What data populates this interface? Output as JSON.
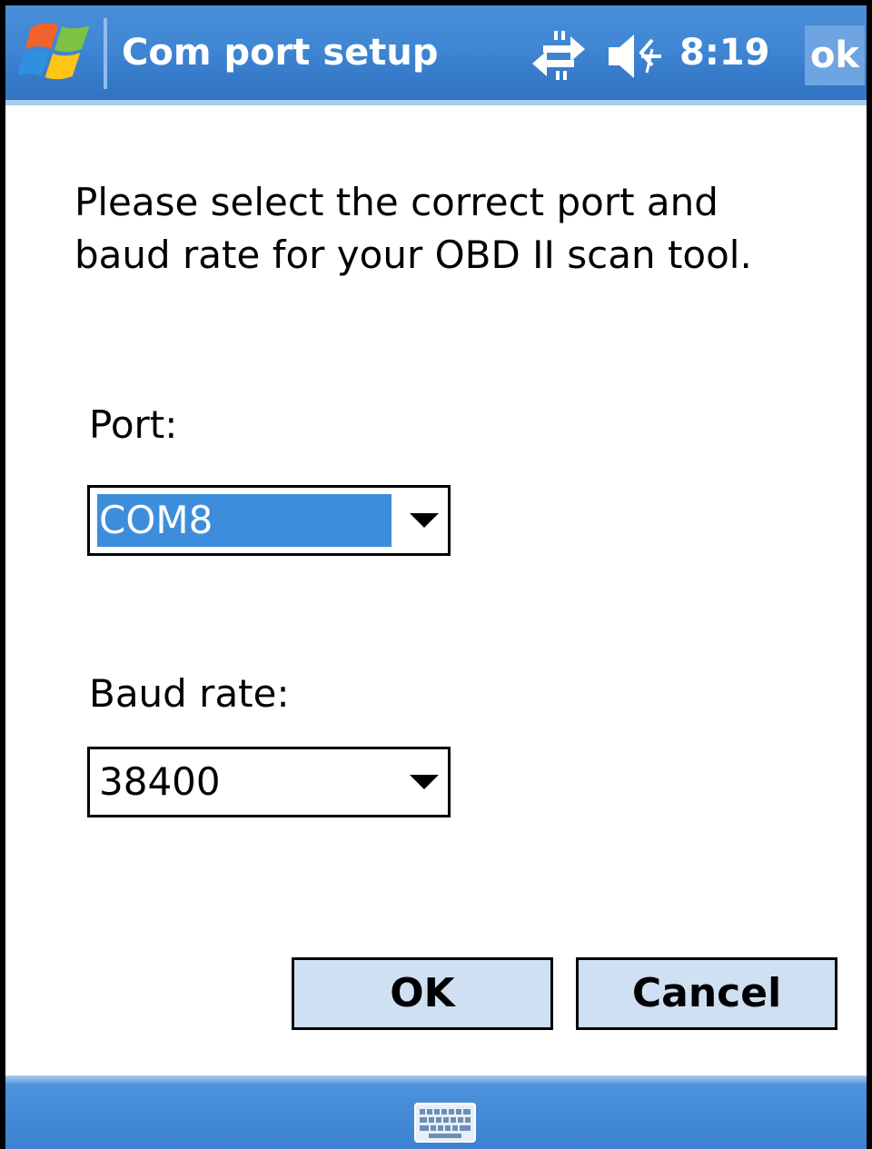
{
  "titlebar": {
    "title": "Com port setup",
    "time": "8:19",
    "ok_label": "ok",
    "icons": [
      "windows-start-icon",
      "connectivity-icon",
      "speaker-muted-icon"
    ]
  },
  "dialog": {
    "instructions": "Please select the correct port and\nbaud rate for your OBD  II scan tool.",
    "port_label": "Port:",
    "port_value": "COM8",
    "baud_label": "Baud rate:",
    "baud_value": "38400",
    "ok_button": "OK",
    "cancel_button": "Cancel"
  },
  "menubar": {
    "icons": [
      "keyboard-icon"
    ]
  },
  "colors": {
    "titlebar_blue": "#3f86d4",
    "selection_blue": "#3c8edc",
    "button_fill": "#cfe0f3"
  }
}
